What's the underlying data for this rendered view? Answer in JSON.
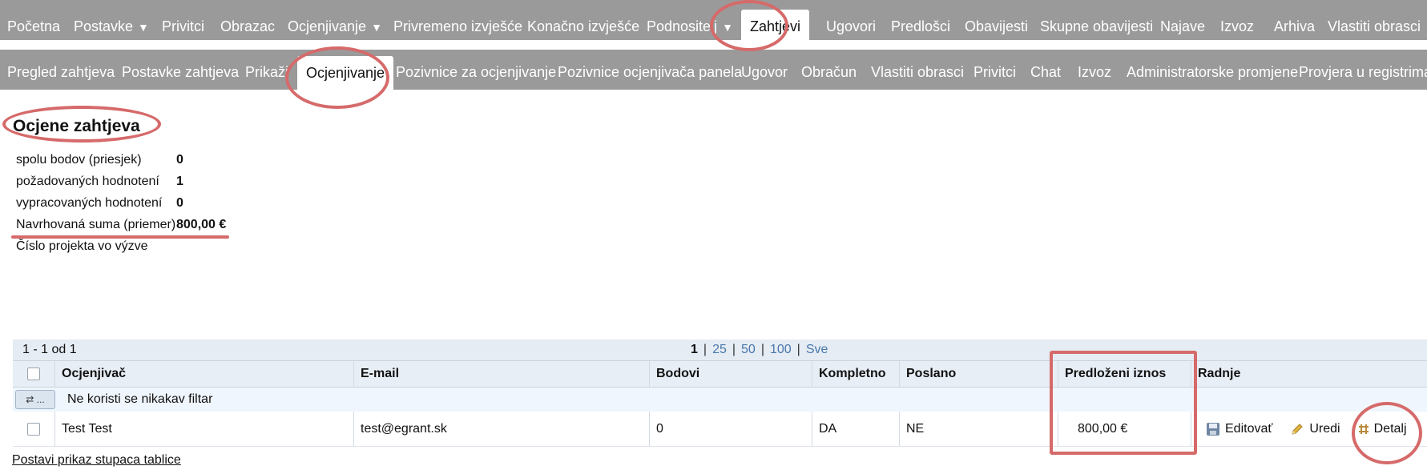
{
  "topnav": {
    "items": [
      {
        "label": "Početna"
      },
      {
        "label": "Postavke",
        "caret": "▼"
      },
      {
        "label": "Privitci"
      },
      {
        "label": "Obrazac"
      },
      {
        "label": "Ocjenjivanje",
        "caret": "▼"
      },
      {
        "label": "Privremeno izvješće"
      },
      {
        "label": "Konačno izvješće"
      },
      {
        "label": "Podnositelj",
        "caret": "▼"
      },
      {
        "label": "Zahtjevi",
        "active": true
      },
      {
        "label": "Ugovori"
      },
      {
        "label": "Predlošci"
      },
      {
        "label": "Obavijesti"
      },
      {
        "label": "Skupne obavijesti"
      },
      {
        "label": "Najave"
      },
      {
        "label": "Izvoz"
      },
      {
        "label": "Arhiva"
      },
      {
        "label": "Vlastiti obrasci"
      }
    ]
  },
  "subnav": {
    "items": [
      {
        "label": "Pregled zahtjeva"
      },
      {
        "label": "Postavke zahtjeva"
      },
      {
        "label": "Prikaži"
      },
      {
        "label": "Ocjenjivanje",
        "active": true
      },
      {
        "label": "Pozivnice za ocjenjivanje"
      },
      {
        "label": "Pozivnice ocjenjivača panela"
      },
      {
        "label": "Ugovor"
      },
      {
        "label": "Obračun"
      },
      {
        "label": "Vlastiti obrasci"
      },
      {
        "label": "Privitci"
      },
      {
        "label": "Chat"
      },
      {
        "label": "Izvoz"
      },
      {
        "label": "Administratorske promjene"
      },
      {
        "label": "Provjera u registrima"
      }
    ]
  },
  "page": {
    "title": "Ocjene zahtjeva"
  },
  "summary": [
    {
      "label": "spolu bodov (priesjek)",
      "value": "0"
    },
    {
      "label": "požadovaných hodnotení",
      "value": "1"
    },
    {
      "label": "vypracovaných hodnotení",
      "value": "0"
    },
    {
      "label": "Navrhovaná suma (priemer)",
      "value": "800,00 €"
    },
    {
      "label": "Číslo projekta vo výzve",
      "value": ""
    }
  ],
  "pager": {
    "range": "1 - 1 od 1",
    "current": "1",
    "sizes": [
      "25",
      "50",
      "100",
      "Sve"
    ]
  },
  "grid": {
    "columns": [
      "Ocjenjivač",
      "E-mail",
      "Bodovi",
      "Kompletno",
      "Poslano",
      "Predloženi iznos",
      "Radnje"
    ],
    "filter_text": "Ne koristi se nikakav filtar",
    "filter_button": "⇄ ...",
    "rows": [
      {
        "evaluator": "Test Test",
        "email": "test@egrant.sk",
        "points": "0",
        "complete": "DA",
        "sent": "NE",
        "amount": "800,00 €"
      }
    ],
    "actions": {
      "edit_sk": "Editovať",
      "edit": "Uredi",
      "detail": "Detalj"
    }
  },
  "footer": {
    "column_order_link": "Postavi prikaz stupaca tablice"
  },
  "colors": {
    "nav_bg": "#9a9a9a",
    "annotation": "#d66a6a",
    "pager_bg": "#e5ecf3",
    "link": "#4a78ad"
  }
}
